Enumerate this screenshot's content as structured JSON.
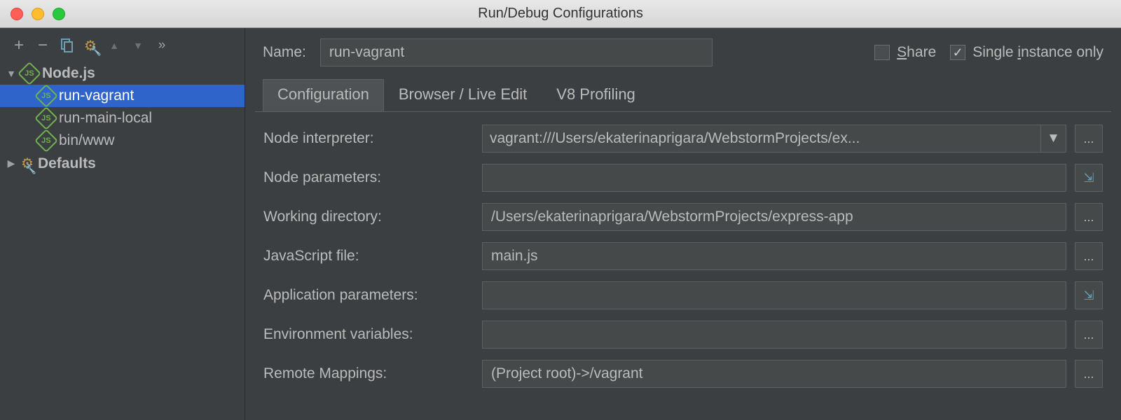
{
  "window": {
    "title": "Run/Debug Configurations"
  },
  "sidebar": {
    "toolbar": {
      "add": "+",
      "remove": "−",
      "copy": "⿻",
      "settings": "⚙",
      "up": "▲",
      "down": "▼",
      "more": "»"
    },
    "nodes": [
      {
        "label": "Node.js",
        "icon": "js",
        "expanded": true,
        "children": [
          {
            "label": "run-vagrant",
            "selected": true
          },
          {
            "label": "run-main-local"
          },
          {
            "label": "bin/www"
          }
        ]
      },
      {
        "label": "Defaults",
        "icon": "gear",
        "expanded": false
      }
    ]
  },
  "header": {
    "name_label": "Name:",
    "name_value": "run-vagrant",
    "share_label": "Share",
    "share_checked": false,
    "single_label": "Single instance only",
    "single_checked": true
  },
  "tabs": [
    {
      "label": "Configuration",
      "active": true
    },
    {
      "label": "Browser / Live Edit"
    },
    {
      "label": "V8 Profiling"
    }
  ],
  "form": {
    "interpreter_label": "Node interpreter:",
    "interpreter_value": "vagrant:///Users/ekaterinaprigara/WebstormProjects/ex...",
    "node_params_label": "Node parameters:",
    "node_params_value": "",
    "workdir_label": "Working directory:",
    "workdir_value": "/Users/ekaterinaprigara/WebstormProjects/express-app",
    "jsfile_label": "JavaScript file:",
    "jsfile_value": "main.js",
    "app_params_label": "Application parameters:",
    "app_params_value": "",
    "env_label": "Environment variables:",
    "env_value": "",
    "remote_label": "Remote Mappings:",
    "remote_value": "(Project root)->/vagrant"
  }
}
